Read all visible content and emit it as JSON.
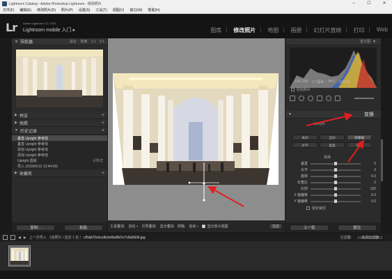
{
  "window": {
    "title": "Lightroom Catalog - Adobe Photoshop Lightroom - 修改照片",
    "controls": [
      "–",
      "☐",
      "✕"
    ]
  },
  "menu": [
    "文件(F)",
    "编辑(E)",
    "修改照片(D)",
    "照片(P)",
    "设置(S)",
    "工具(T)",
    "视图(V)",
    "窗口(W)",
    "帮助(H)"
  ],
  "identity": {
    "logo": "Lr",
    "small": "Adobe Lightroom CC 2015",
    "main": "Lightroom mobile 入门 ▸"
  },
  "modules": {
    "items": [
      "图库",
      "修改照片",
      "地图",
      "画册",
      "幻灯片放映",
      "打印",
      "Web"
    ],
    "active": "修改照片"
  },
  "left_panel": {
    "navigator": {
      "label": "导航器",
      "options": [
        "适合",
        "填满",
        "1:1",
        "3:1"
      ]
    },
    "presets": {
      "label": "预设"
    },
    "snapshots": {
      "label": "快照"
    },
    "history": {
      "label": "历史记录",
      "items": [
        {
          "text": "垂直 Upright 参考线",
          "right": "",
          "selected": true
        },
        {
          "text": "垂直 Upright 参考线",
          "right": ""
        },
        {
          "text": "添加 Upright 参考线",
          "right": ""
        },
        {
          "text": "添加 Upright 参考线",
          "right": ""
        },
        {
          "text": "Upright 透视",
          "right": "引导式"
        },
        {
          "text": "导入 (2018/6/12 12:44:09)",
          "right": ""
        }
      ]
    },
    "collections": {
      "label": "收藏夹"
    },
    "buttons": {
      "copy": "复制...",
      "paste": "粘贴"
    }
  },
  "toolbar": {
    "tool_overlay": "工具叠加:",
    "tool_overlay_value": "自动 ÷",
    "upright_label": "引导叠加:",
    "show_label": "显示叠加",
    "grid_label": "网格:",
    "grid_value": "自动 ÷",
    "loupe_label": "显示放大视图",
    "done": "完成"
  },
  "right_panel": {
    "histogram_label": "直方图",
    "hist_values": [
      "ISO 100",
      "17 毫米",
      "f/4.0",
      "1/30 秒"
    ],
    "original_photo": "原始照片",
    "transform": {
      "label": "变换"
    },
    "upright_label": "Upright",
    "upright_buttons": [
      [
        "关闭",
        "自动",
        "引导式"
      ],
      [
        "水平",
        "垂直",
        "完全"
      ]
    ],
    "active_upright": "引导式",
    "transform_section": "变换",
    "sliders": [
      {
        "label": "垂直",
        "value": "0"
      },
      {
        "label": "水平",
        "value": "0"
      },
      {
        "label": "旋转",
        "value": "0.0"
      },
      {
        "label": "长宽比",
        "value": "0"
      },
      {
        "label": "比例",
        "value": "100"
      },
      {
        "label": "X 轴偏移",
        "value": "0.0"
      },
      {
        "label": "Y 轴偏移",
        "value": "0.0"
      }
    ],
    "crop_lock": "锁定裁剪",
    "buttons": {
      "previous": "上一张",
      "reset": "复位"
    }
  },
  "filmstrip_bar": {
    "nav": "上一次导入",
    "count": "1张照片 / 选定 1 张 /",
    "filename": "cf5dd70cfecd6cb45e8fd7e7c8a5606.jpg",
    "filter_label": "过滤器:",
    "filter_value": "关闭过滤器"
  },
  "colors": {
    "accent_arrow": "#e02020",
    "panel_bg": "#2b2b2b",
    "canvas_bg": "#8d8d8d"
  }
}
